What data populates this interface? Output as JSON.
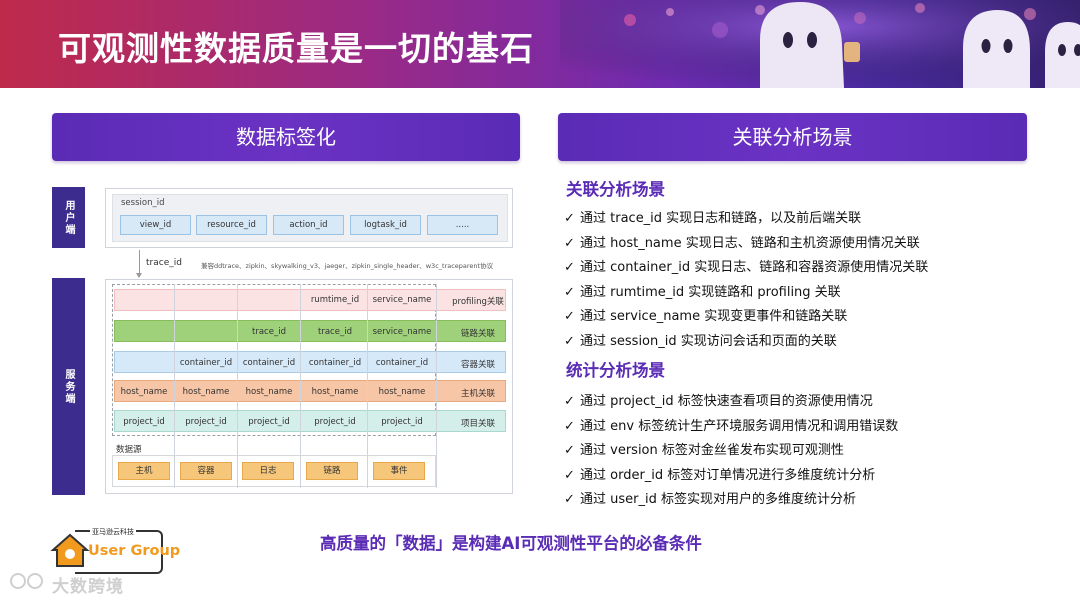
{
  "header": {
    "title": "可观测性数据质量是一切的基石"
  },
  "banners": {
    "left": "数据标签化",
    "right": "关联分析场景"
  },
  "diagram": {
    "side_user": "用户端",
    "side_service": "服务端",
    "session_label": "session_id",
    "user_chips": [
      "view_id",
      "resource_id",
      "action_id",
      "logtask_id",
      "....."
    ],
    "trace_label": "trace_id",
    "trace_compat": "兼容ddtrace、zipkin、skywalking_v3、jaeger、zipkin_single_header、w3c_traceparent协议",
    "rows": [
      {
        "cells": [
          "",
          "",
          "",
          "rumtime_id",
          "service_name"
        ],
        "label": "profiling关联"
      },
      {
        "cells": [
          "",
          "",
          "trace_id",
          "trace_id",
          "service_name"
        ],
        "label": "链路关联"
      },
      {
        "cells": [
          "",
          "container_id",
          "container_id",
          "container_id",
          "container_id"
        ],
        "label": "容器关联"
      },
      {
        "cells": [
          "host_name",
          "host_name",
          "host_name",
          "host_name",
          "host_name"
        ],
        "label": "主机关联"
      },
      {
        "cells": [
          "project_id",
          "project_id",
          "project_id",
          "project_id",
          "project_id"
        ],
        "label": "项目关联"
      }
    ],
    "datasource_label": "数据源",
    "datasources": [
      "主机",
      "容器",
      "日志",
      "链路",
      "事件"
    ]
  },
  "right": {
    "section1_title": "关联分析场景",
    "section1_items": [
      "通过 trace_id 实现日志和链路，以及前后端关联",
      "通过 host_name 实现日志、链路和主机资源使用情况关联",
      "通过 container_id 实现日志、链路和容器资源使用情况关联",
      "通过 rumtime_id 实现链路和 profiling 关联",
      "通过 service_name 实现变更事件和链路关联",
      "通过 session_id 实现访问会话和页面的关联"
    ],
    "section2_title": "统计分析场景",
    "section2_items": [
      "通过 project_id 标签快速查看项目的资源使用情况",
      "通过 env 标签统计生产环境服务调用情况和调用错误数",
      "通过 version 标签对金丝雀发布实现可观测性",
      "通过 order_id 标签对订单情况进行多维度统计分析",
      "通过 user_id 标签实现对用户的多维度统计分析"
    ],
    "check_mark": "✓"
  },
  "footer_note": "高质量的「数据」是构建AI可观测性平台的必备条件",
  "logo": {
    "small_text": "亚马逊云科技",
    "group_text": "User Group",
    "watermark": "大数跨境"
  }
}
